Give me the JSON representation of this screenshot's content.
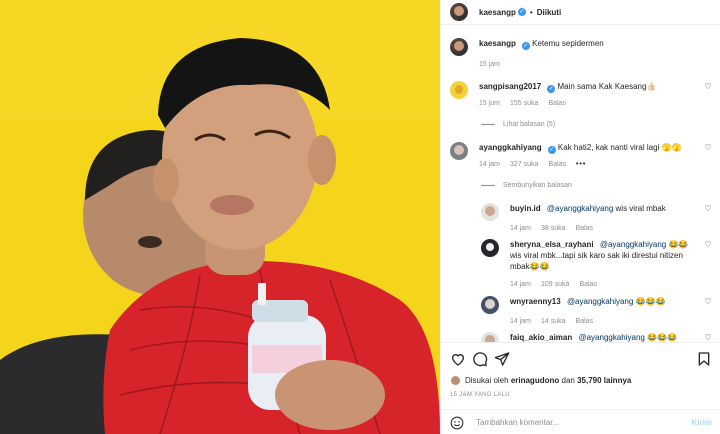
{
  "header": {
    "username": "kaesangp",
    "separator": "•",
    "follow_label": "Diikuti"
  },
  "caption": {
    "username": "kaesangp",
    "text": "Ketemu sepidermen",
    "time": "15 jam"
  },
  "comments": [
    {
      "username": "sangpisang2017",
      "text": "Main sama Kak Kaesang👍🏻",
      "time": "15 jum",
      "likes": "155 suka",
      "reply_label": "Balas",
      "toggle": "Lihat balasan (5)"
    },
    {
      "username": "ayanggkahiyang",
      "text": "Kak hati2, kak nanti viral lagi 🫣🫣",
      "time": "14 jam",
      "likes": "327 suka",
      "reply_label": "Balas",
      "more": "•••",
      "toggle": "Sembunyikan balasan"
    }
  ],
  "replies": [
    {
      "username": "buyin.id",
      "mention": "@ayanggkahiyang",
      "text": " wis viral mbak",
      "time": "14 jam",
      "likes": "38 suka",
      "reply_label": "Balas"
    },
    {
      "username": "sheryna_elsa_rayhani",
      "mention": "@ayanggkahiyang",
      "text": " 😂😂wis viral mbk...tapi sik karo sak iki direstui nitizen mbak😂😂",
      "time": "14 jam",
      "likes": "109 suka",
      "reply_label": "Balas"
    },
    {
      "username": "wnyraenny13",
      "mention": "@ayanggkahiyang",
      "text": " 😂😂😂",
      "time": "14 jam",
      "likes": "14 suka",
      "reply_label": "Balas"
    },
    {
      "username": "faiq_akio_aiman",
      "mention": "@ayanggkahiyang",
      "text": " 😂😂😂"
    }
  ],
  "likes_line": {
    "prefix": "Disukai oleh ",
    "user": "erinagudono",
    "middle": " dan ",
    "count": "35,790 lainnya"
  },
  "timestamp": "15 JAM YANG LALU",
  "comment_input": {
    "placeholder": "Tambahkan komentar...",
    "send_label": "Kirim"
  }
}
